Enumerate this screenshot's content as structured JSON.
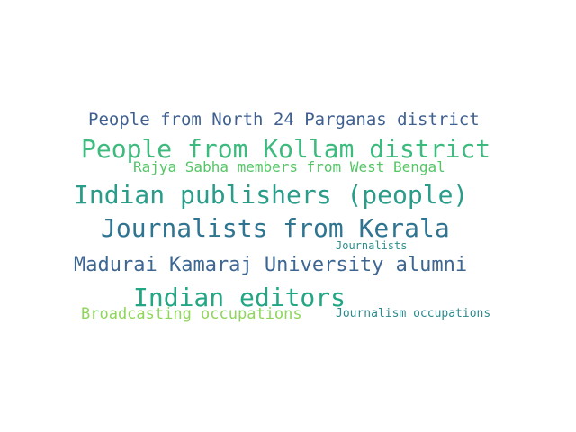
{
  "words": [
    {
      "text": "People from North 24 Parganas district",
      "color": "#3f5f8f"
    },
    {
      "text": "People from Kollam district",
      "color": "#3dba7e"
    },
    {
      "text": "Rajya Sabha members from West Bengal",
      "color": "#55c567"
    },
    {
      "text": "Indian publishers (people)",
      "color": "#2a9d8a"
    },
    {
      "text": "Journalists from Kerala",
      "color": "#2f7490"
    },
    {
      "text": "Journalists",
      "color": "#2c8e8c"
    },
    {
      "text": "Madurai Kamaraj University alumni",
      "color": "#3d6692"
    },
    {
      "text": "Indian editors",
      "color": "#22a684"
    },
    {
      "text": "Broadcasting occupations",
      "color": "#8ed65a"
    },
    {
      "text": "Journalism occupations",
      "color": "#2c8a8c"
    }
  ]
}
